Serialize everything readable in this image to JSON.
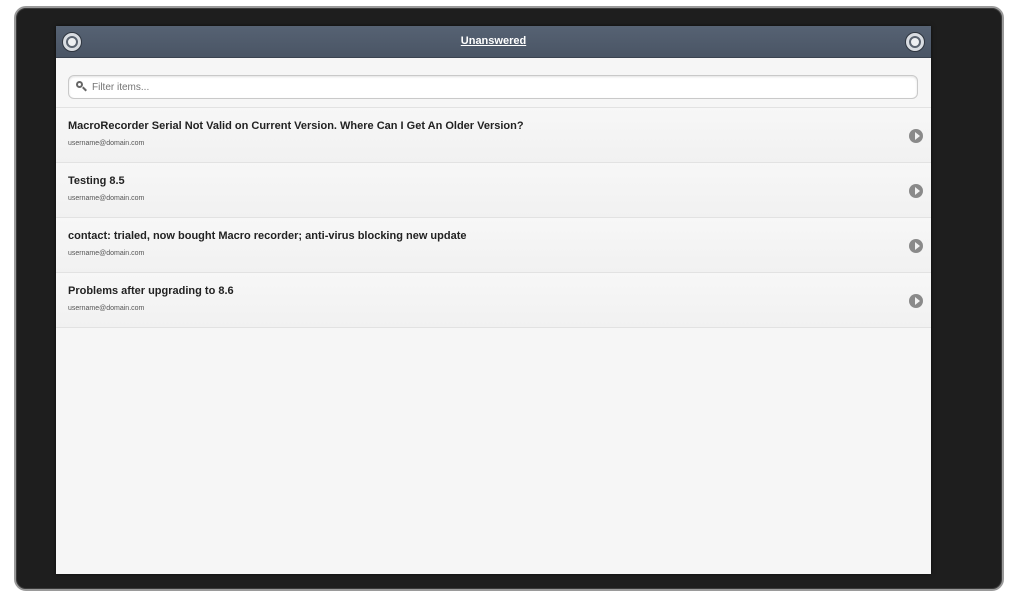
{
  "header": {
    "title": "Unanswered",
    "left_icon": "settings-icon",
    "right_icon": "refresh-icon"
  },
  "filter": {
    "placeholder": "Filter items...",
    "value": ""
  },
  "items": [
    {
      "title": "MacroRecorder Serial Not Valid on Current Version. Where Can I Get An Older Version?",
      "email": "username@domain.com"
    },
    {
      "title": "Testing 8.5",
      "email": "username@domain.com"
    },
    {
      "title": "contact: trialed, now bought Macro recorder; anti-virus blocking new update",
      "email": "username@domain.com"
    },
    {
      "title": "Problems after upgrading to 8.6",
      "email": "username@domain.com"
    }
  ],
  "colors": {
    "header_bg": "#4f5a6a",
    "list_bg": "#f6f6f6",
    "frame_bg": "#1e1e1e"
  }
}
